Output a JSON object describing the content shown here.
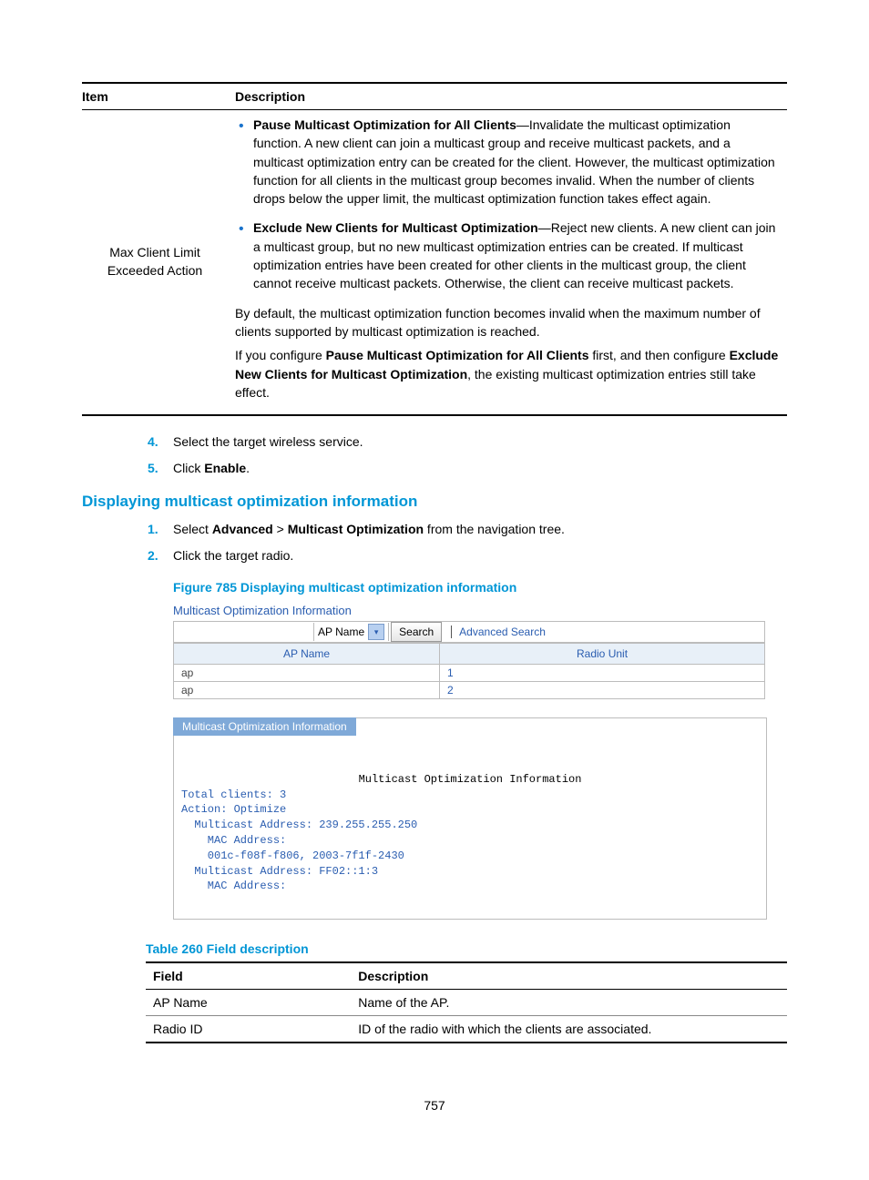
{
  "mainTable": {
    "headerItem": "Item",
    "headerDesc": "Description",
    "itemLabel": "Max Client Limit Exceeded Action",
    "bullet1Bold": "Pause Multicast Optimization for All Clients",
    "bullet1Rest": "—Invalidate the multicast optimization function. A new client can join a multicast group and receive multicast packets, and a multicast optimization entry can be created for the client. However, the multicast optimization function for all clients in the multicast group becomes invalid. When the number of clients drops below the upper limit, the multicast optimization function takes effect again.",
    "bullet2Bold": "Exclude New Clients for Multicast Optimization",
    "bullet2Rest": "—Reject new clients. A new client can join a multicast group, but no new multicast optimization entries can be created. If multicast optimization entries have been created for other clients in the multicast group, the client cannot receive multicast packets. Otherwise, the client can receive multicast packets.",
    "para1": "By default, the multicast optimization function becomes invalid when the maximum number of clients supported by multicast optimization is reached.",
    "para2a": "If you configure ",
    "para2b": "Pause Multicast Optimization for All Clients",
    "para2c": " first, and then configure ",
    "para2d": "Exclude New Clients for Multicast Optimization",
    "para2e": ", the existing multicast optimization entries still take effect."
  },
  "steps1": {
    "n4": "4.",
    "t4": "Select the target wireless service.",
    "n5": "5.",
    "t5a": "Click ",
    "t5b": "Enable",
    "t5c": "."
  },
  "sectionHeading": "Displaying multicast optimization information",
  "steps2": {
    "n1": "1.",
    "t1a": "Select ",
    "t1b": "Advanced",
    "t1c": " > ",
    "t1d": "Multicast Optimization",
    "t1e": " from the navigation tree.",
    "n2": "2.",
    "t2": "Click the target radio."
  },
  "figureCaption": "Figure 785 Displaying multicast optimization information",
  "screenshot": {
    "title": "Multicast Optimization Information",
    "selectValue": "AP Name",
    "searchBtn": "Search",
    "advLink": "Advanced Search",
    "colAP": "AP Name",
    "colRadio": "Radio Unit",
    "rows": [
      {
        "ap": "ap",
        "radio": "1"
      },
      {
        "ap": "ap",
        "radio": "2"
      }
    ]
  },
  "infoPanel": {
    "tab": "Multicast Optimization Information",
    "centerTitle": "Multicast Optimization Information",
    "body": "Total clients: 3\nAction: Optimize\n  Multicast Address: 239.255.255.250\n    MAC Address:\n    001c-f08f-f806, 2003-7f1f-2430\n  Multicast Address: FF02::1:3\n    MAC Address:"
  },
  "tableCaption": "Table 260 Field description",
  "fieldTable": {
    "hField": "Field",
    "hDesc": "Description",
    "rows": [
      {
        "f": "AP Name",
        "d": "Name of the AP."
      },
      {
        "f": "Radio ID",
        "d": "ID of the radio with which the clients are associated."
      }
    ]
  },
  "pageNum": "757"
}
